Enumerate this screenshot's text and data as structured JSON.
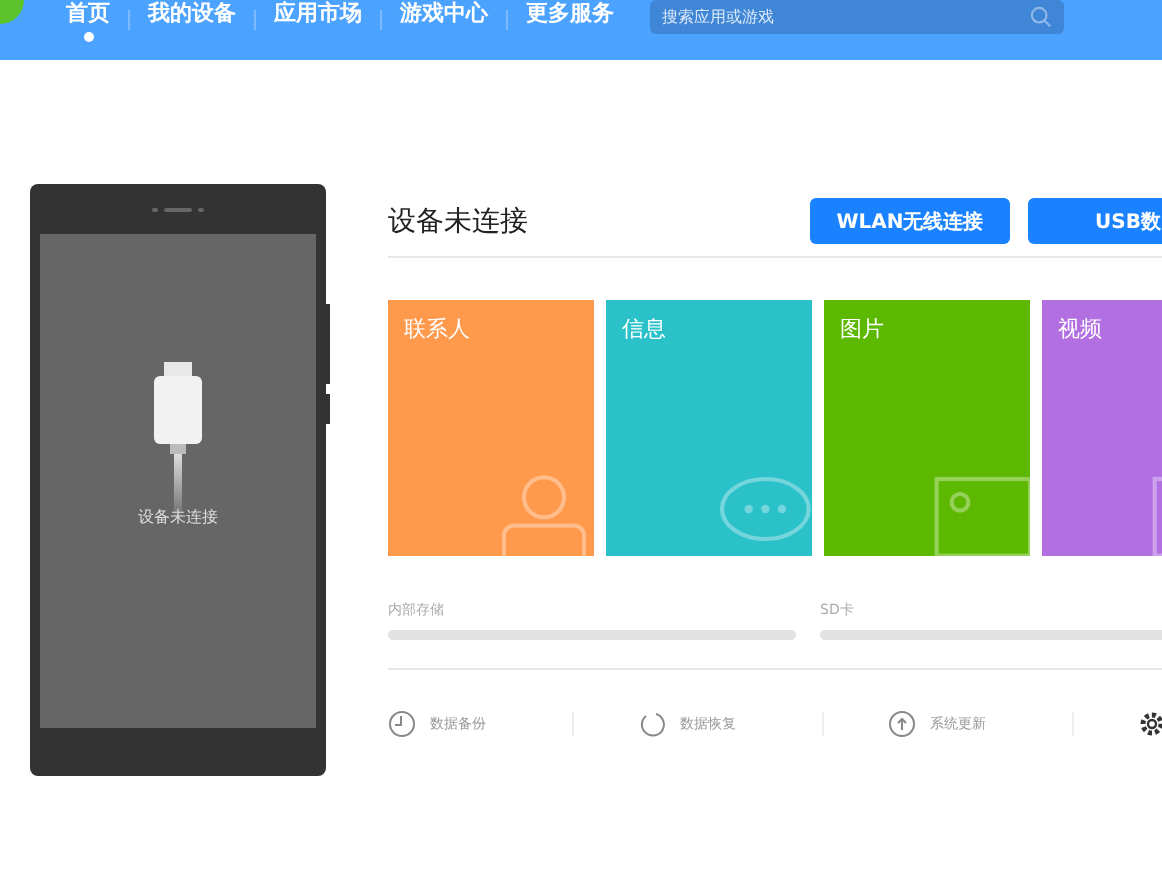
{
  "nav": {
    "items": [
      {
        "label": "首页",
        "selected": true
      },
      {
        "label": "我的设备",
        "selected": false
      },
      {
        "label": "应用市场",
        "selected": false
      },
      {
        "label": "游戏中心",
        "selected": false
      },
      {
        "label": "更多服务",
        "selected": false
      }
    ],
    "search": {
      "placeholder": "搜索应用或游戏"
    }
  },
  "phone": {
    "status": "设备未连接"
  },
  "panel": {
    "title": "设备未连接",
    "buttons": [
      "WLAN无线连接",
      "USB数"
    ],
    "tiles": [
      {
        "kind": "contacts",
        "label": "联系人",
        "color": "#ff9a4d"
      },
      {
        "kind": "messages",
        "label": "信息",
        "color": "#2ac1c9"
      },
      {
        "kind": "photos",
        "label": "图片",
        "color": "#5cb800"
      },
      {
        "kind": "videos",
        "label": "视频",
        "color": "#b26fe2"
      }
    ],
    "storage": [
      {
        "label": "内部存储",
        "level": 0
      },
      {
        "label": "SD卡",
        "level": 0
      }
    ],
    "actions": [
      {
        "kind": "backup",
        "label": "数据备份"
      },
      {
        "kind": "restore",
        "label": "数据恢复"
      },
      {
        "kind": "update",
        "label": "系统更新"
      },
      {
        "kind": "settings"
      }
    ]
  }
}
